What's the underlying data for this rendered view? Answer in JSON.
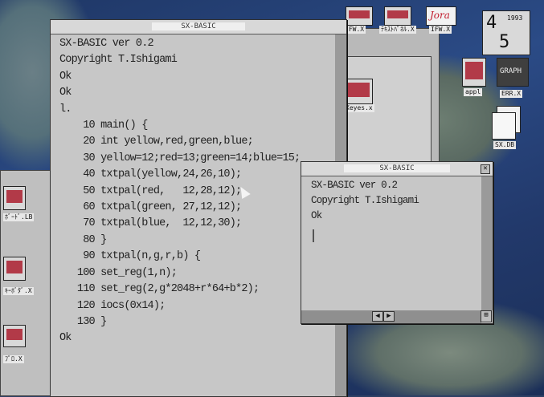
{
  "main_window": {
    "title": "SX-BASIC",
    "lines": [
      "SX-BASIC ver 0.2",
      "Copyright T.Ishigami",
      "Ok",
      "Ok",
      "l.",
      "    10 main() {",
      "    20 int yellow,red,green,blue;",
      "    30 yellow=12;red=13;green=14;blue=15;",
      "    40 txtpal(yellow,24,26,10);",
      "    50 txtpal(red,   12,28,12);",
      "    60 txtpal(green, 27,12,12);",
      "    70 txtpal(blue,  12,12,30);",
      "    80 }",
      "    90 txtpal(n,g,r,b) {",
      "   100 set_reg(1,n);",
      "   110 set_reg(2,g*2048+r*64+b*2);",
      "   120 iocs(0x14);",
      "   130 }",
      "Ok"
    ]
  },
  "second_window": {
    "title": "SX-BASIC",
    "lines": [
      "SX-BASIC ver 0.2",
      "Copyright T.Ishigami",
      "Ok"
    ],
    "close_icon": "close-icon",
    "scroll_left_icon": "arrow-left-icon",
    "scroll_right_icon": "arrow-right-icon"
  },
  "desktop_icons": {
    "top1": "IFW.X",
    "top2": "ﾃｷｽﾄﾊﾟﾈﾙ.X",
    "top3": "IFW.X",
    "brand": "Jora",
    "graph": "GRAPH",
    "appl": "appl",
    "exe": "ERR.X",
    "sx_db": "SX.DB",
    "xeyes": "Xeyes.x",
    "left1": "ﾎﾞｰﾄﾞ.LB",
    "left2": "ｷｰﾎﾞﾀﾞ.X",
    "left3": "ﾌﾟﾛ.X"
  },
  "calendar": {
    "month": "4",
    "year": "1993",
    "day": "5"
  }
}
